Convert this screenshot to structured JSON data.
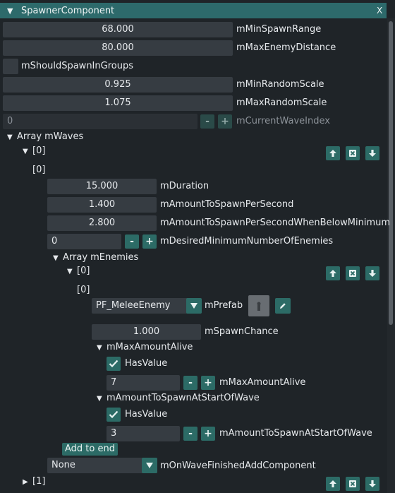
{
  "component": {
    "title": "SpawnerComponent",
    "close_label": "X"
  },
  "props": {
    "min_spawn_range": {
      "value": "68.000",
      "label": "mMinSpawnRange"
    },
    "max_enemy_distance": {
      "value": "80.000",
      "label": "mMaxEnemyDistance"
    },
    "should_spawn_in_groups": {
      "label": "mShouldSpawnInGroups",
      "checked": false
    },
    "min_random_scale": {
      "value": "0.925",
      "label": "mMinRandomScale"
    },
    "max_random_scale": {
      "value": "1.075",
      "label": "mMaxRandomScale"
    },
    "current_wave_index": {
      "value": "0",
      "label": "mCurrentWaveIndex"
    }
  },
  "waves": {
    "array_label": "Array mWaves",
    "item0_header": "[0]",
    "item0_sub": "[0]",
    "duration": {
      "value": "15.000",
      "label": "mDuration"
    },
    "amount_per_second": {
      "value": "1.400",
      "label": "mAmountToSpawnPerSecond"
    },
    "amount_below_min": {
      "value": "2.800",
      "label": "mAmountToSpawnPerSecondWhenBelowMinimum"
    },
    "desired_min": {
      "value": "0",
      "label": "mDesiredMinimumNumberOfEnemies"
    },
    "enemies": {
      "array_label": "Array mEnemies",
      "item0_header": "[0]",
      "item0_sub": "[0]",
      "prefab": {
        "value": "PF_MeleeEnemy",
        "label": "mPrefab"
      },
      "spawn_chance": {
        "value": "1.000",
        "label": "mSpawnChance"
      },
      "max_alive": {
        "group_label": "mMaxAmountAlive",
        "has_value_label": "HasValue",
        "value": "7",
        "label": "mMaxAmountAlive"
      },
      "at_start": {
        "group_label": "mAmountToSpawnAtStartOfWave",
        "has_value_label": "HasValue",
        "value": "3",
        "label": "mAmountToSpawnAtStartOfWave"
      },
      "add_to_end_label": "Add to end"
    },
    "on_finished": {
      "value": "None",
      "label": "mOnWaveFinishedAddComponent"
    },
    "item1_header": "[1]"
  },
  "stepper": {
    "minus": "-",
    "plus": "+"
  },
  "colors": {
    "header": "#2d6a6b",
    "button": "#2c6b66",
    "field": "#363c42",
    "background": "#1f2428"
  }
}
